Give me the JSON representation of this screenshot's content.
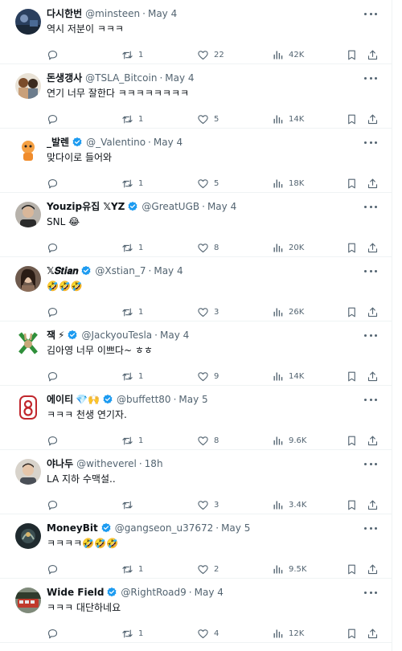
{
  "tweets": [
    {
      "name": "다시한번",
      "extra": "",
      "handle": "@minsteen",
      "time": "May 4",
      "text": "역시 저분이 ㅋㅋㅋ",
      "retweets": "1",
      "likes": "22",
      "views": "42K",
      "avatar": "dark-blue-night"
    },
    {
      "name": "돈생갱사",
      "extra": "",
      "handle": "@TSLA_Bitcoin",
      "time": "May 4",
      "text": "연기 너무 잘한다 ㅋㅋㅋㅋㅋㅋㅋㅋ",
      "retweets": "1",
      "likes": "5",
      "views": "14K",
      "avatar": "cartoon-people"
    },
    {
      "name": "_발렌",
      "extra": "",
      "handle": "@_Valentino",
      "time": "May 4",
      "text": "맞다이로 들어와",
      "retweets": "1",
      "likes": "5",
      "views": "18K",
      "avatar": "orange-character"
    },
    {
      "name": "Youzip유집 𝕏YZ",
      "extra": "",
      "handle": "@GreatUGB",
      "time": "May 4",
      "text": "SNL 😂",
      "retweets": "1",
      "likes": "8",
      "views": "20K",
      "avatar": "man-photo"
    },
    {
      "name": "𝕏𝑺𝒕𝒊𝒂𝒏",
      "extra": "",
      "handle": "@Xstian_7",
      "time": "May 4",
      "text": "🤣🤣🤣",
      "retweets": "1",
      "likes": "3",
      "views": "26K",
      "avatar": "woman-photo"
    },
    {
      "name": "잭",
      "extra": "⚡",
      "handle": "@JackyouTesla",
      "time": "May 4",
      "text": "김아영 너무 이쁘다~ ㅎㅎ",
      "retweets": "1",
      "likes": "9",
      "views": "14K",
      "avatar": "green-x-rabbit"
    },
    {
      "name": "에이티",
      "extra": "💎🙌",
      "handle": "@buffett80",
      "time": "May 5",
      "text": "ㅋㅋㅋ 천생 연기자.",
      "retweets": "1",
      "likes": "8",
      "views": "9.6K",
      "avatar": "red-80-logo"
    },
    {
      "name": "야나두",
      "extra": "",
      "handle": "@witheverel",
      "time": "18h",
      "text": "LA 지하 수맥설..",
      "retweets": "",
      "likes": "3",
      "views": "3.4K",
      "avatar": "man-light"
    },
    {
      "name": "MoneyBit",
      "extra": "",
      "handle": "@gangseon_u37672",
      "time": "May 5",
      "text": "ㅋㅋㅋㅋ🤣🤣🤣",
      "retweets": "1",
      "likes": "2",
      "views": "9.5K",
      "avatar": "dark-logo"
    },
    {
      "name": "Wide Field",
      "extra": "",
      "handle": "@RightRoad9",
      "time": "May 4",
      "text": "ㅋㅋㅋ 대단하네요",
      "retweets": "1",
      "likes": "4",
      "views": "12K",
      "avatar": "red-bus"
    }
  ],
  "colors": {
    "icon": "#536471",
    "verified": "#1d9bf0",
    "text": "#0f1419",
    "border": "#eff3f4"
  }
}
